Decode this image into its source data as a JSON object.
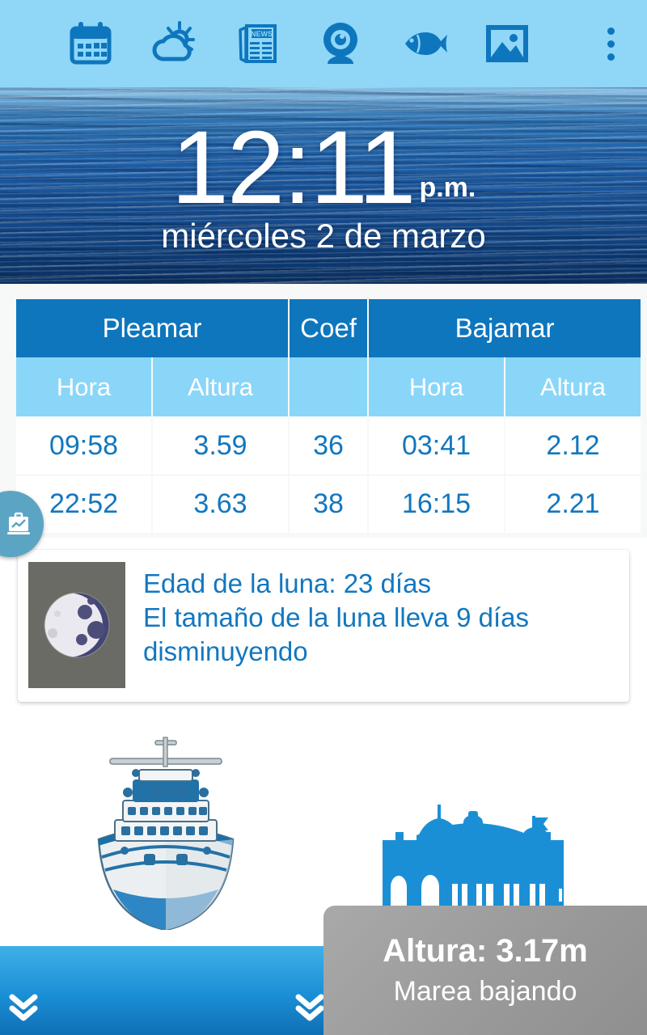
{
  "topbar": {
    "background_color": "#8fd6f7",
    "icon_color": "#0e76bd",
    "items": [
      {
        "name": "calendar-icon",
        "label": "Calendario"
      },
      {
        "name": "weather-icon",
        "label": "Tiempo"
      },
      {
        "name": "news-icon",
        "label": "Noticias",
        "badge_text": "NEWS"
      },
      {
        "name": "webcam-icon",
        "label": "Webcam"
      },
      {
        "name": "fish-icon",
        "label": "Pesca"
      },
      {
        "name": "gallery-icon",
        "label": "Galería"
      }
    ],
    "overflow_label": "Más opciones"
  },
  "clock": {
    "time": "12:11",
    "ampm": "p.m.",
    "date": "miércoles 2 de marzo"
  },
  "tide_table": {
    "group_headers": [
      "Pleamar",
      "Coef",
      "Bajamar"
    ],
    "sub_headers": [
      "Hora",
      "Altura",
      "",
      "Hora",
      "Altura"
    ],
    "rows": [
      {
        "high_time": "09:58",
        "high_height": "3.59",
        "coef": "36",
        "low_time": "03:41",
        "low_height": "2.12"
      },
      {
        "high_time": "22:52",
        "high_height": "3.63",
        "coef": "38",
        "low_time": "16:15",
        "low_height": "2.21"
      }
    ],
    "header_color": "#0e76bd",
    "subheader_color": "#8ad6f9",
    "value_color": "#1277bf"
  },
  "side_tab": {
    "icon": "chart-briefcase-icon",
    "color": "#5ca4c4"
  },
  "moon": {
    "age_text": "Edad de la luna: 23 días",
    "phase_text": "El tamaño de la luna lleva 9 días disminuyendo",
    "line1": "Edad de la luna: 23 días",
    "line2": "El tamaño de la luna lleva 9 días",
    "line3": "disminuyendo",
    "text_color": "#1277bf",
    "thumb_background": "#6b6b66"
  },
  "scene": {
    "ship_icon": "cruise-ship-icon",
    "building_icon": "casino-building-icon",
    "water_color": "#1b8fd6",
    "chevron_icon": "double-chevron-down-icon"
  },
  "tide_overlay": {
    "height_label": "Altura: 3.17m",
    "state_label": "Marea bajando",
    "background_color": "#9a9a9a"
  }
}
